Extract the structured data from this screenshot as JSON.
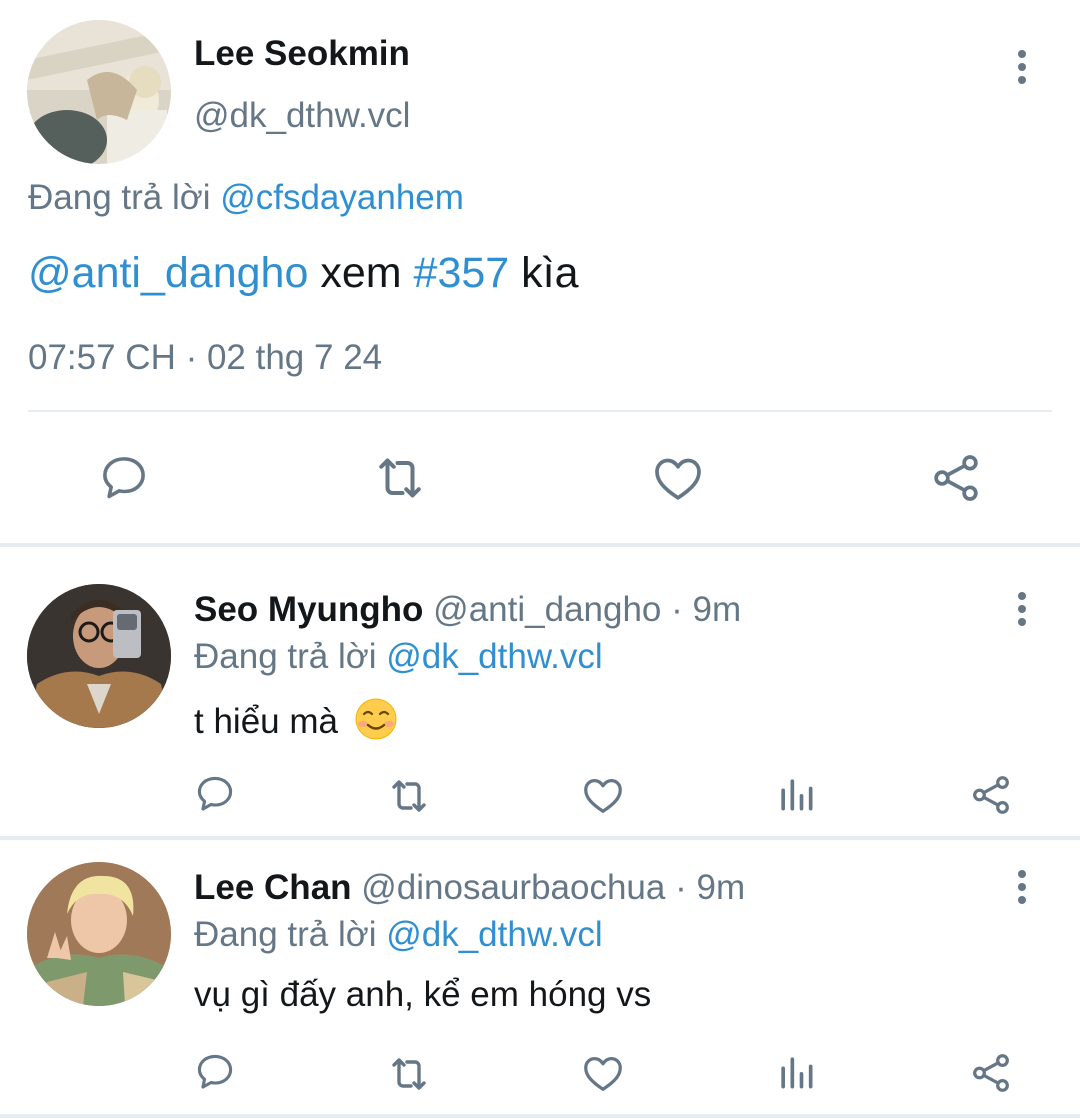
{
  "main_tweet": {
    "author_name": "Lee Seokmin",
    "author_handle": "@dk_dthw.vcl",
    "reply_prefix": "Đang trả lời",
    "reply_to": "@cfsdayanhem",
    "text_mention": "@anti_dangho",
    "text_word1": "xem",
    "text_hashtag": "#357",
    "text_word2": "kìa",
    "timestamp": "07:57 CH · 02 thg 7 24",
    "icons": [
      "reply-icon",
      "retweet-icon",
      "like-icon",
      "share-icon"
    ]
  },
  "replies": [
    {
      "author_name": "Seo Myungho",
      "author_handle": "@anti_dangho",
      "time": "· 9m",
      "reply_prefix": "Đang trả lời",
      "reply_to": "@dk_dthw.vcl",
      "text": "t hiểu mà",
      "emoji": "☺",
      "icons": [
        "reply-icon",
        "retweet-icon",
        "like-icon",
        "analytics-icon",
        "share-icon"
      ]
    },
    {
      "author_name": "Lee Chan",
      "author_handle": "@dinosaurbaochua",
      "time": "· 9m",
      "reply_prefix": "Đang trả lời",
      "reply_to": "@dk_dthw.vcl",
      "text": "vụ gì đấy anh, kể em hóng vs",
      "icons": [
        "reply-icon",
        "retweet-icon",
        "like-icon",
        "analytics-icon",
        "share-icon"
      ]
    }
  ],
  "colors": {
    "link": "#2f8fd0",
    "secondary_text": "#657786",
    "icon": "#657786",
    "divider": "#e6ecf0"
  }
}
